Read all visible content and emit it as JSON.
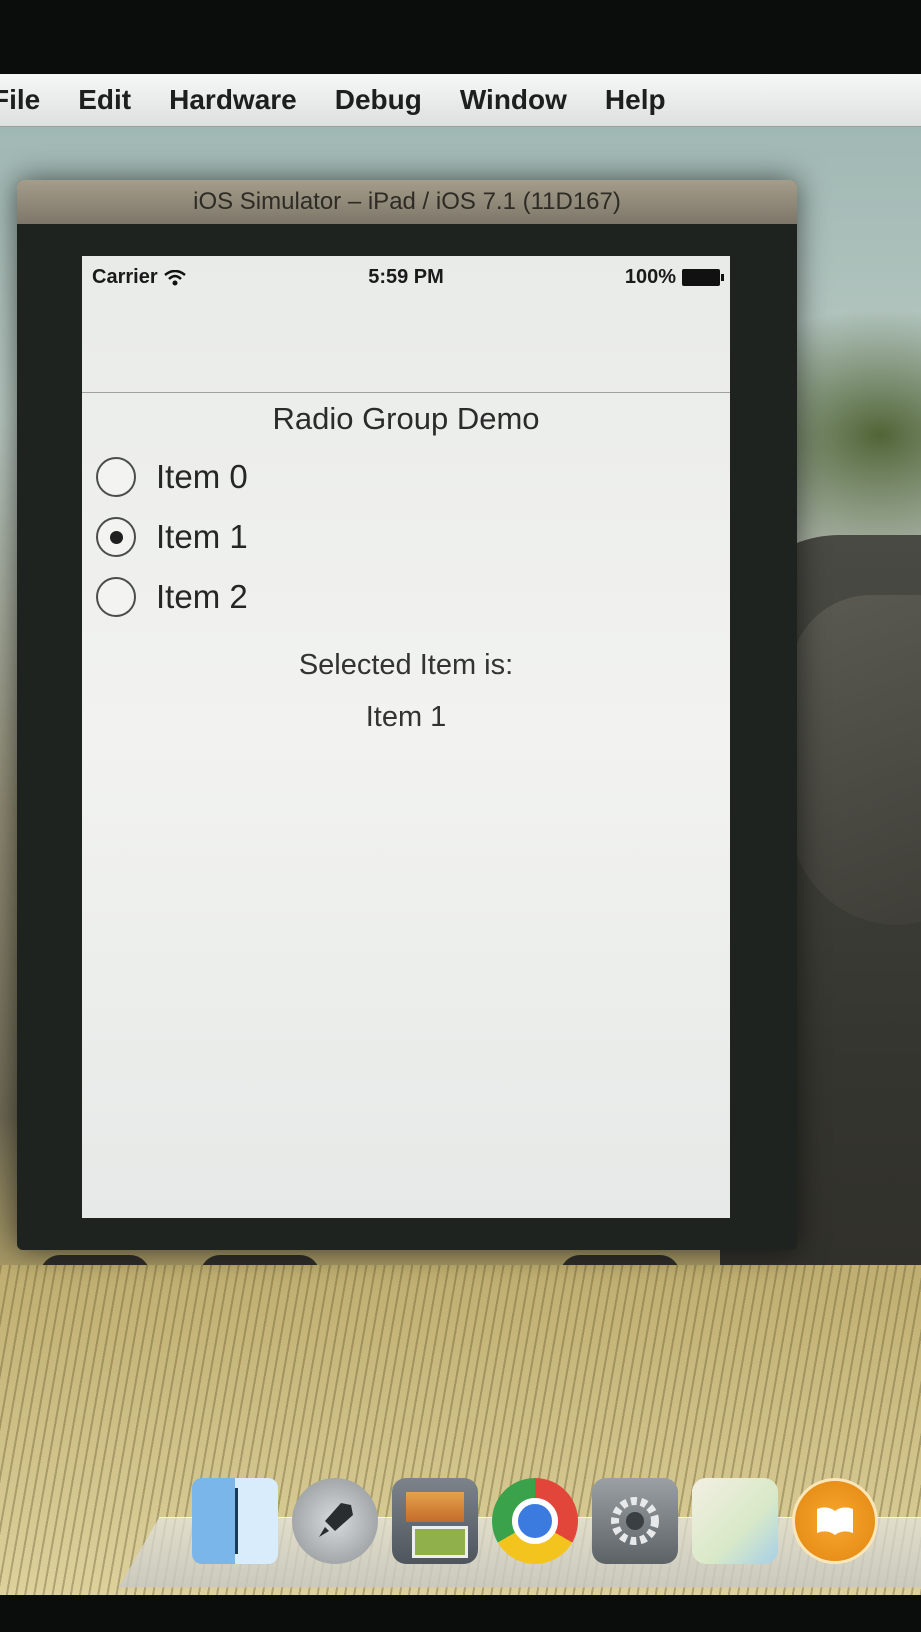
{
  "menubar": {
    "items": [
      "File",
      "Edit",
      "Hardware",
      "Debug",
      "Window",
      "Help"
    ]
  },
  "simulator": {
    "title": "iOS Simulator – iPad / iOS 7.1 (11D167)"
  },
  "statusbar": {
    "carrier": "Carrier",
    "time": "5:59 PM",
    "battery": "100%"
  },
  "app": {
    "title": "Radio Group Demo",
    "options": [
      {
        "label": "Item 0",
        "selected": false
      },
      {
        "label": "Item 1",
        "selected": true
      },
      {
        "label": "Item 2",
        "selected": false
      }
    ],
    "selected_caption": "Selected Item is:",
    "selected_value": "Item 1"
  },
  "dock": {
    "icons": [
      "finder-icon",
      "launchpad-icon",
      "photo-browser-icon",
      "chrome-icon",
      "system-preferences-icon",
      "maps-icon",
      "ibooks-icon"
    ]
  }
}
